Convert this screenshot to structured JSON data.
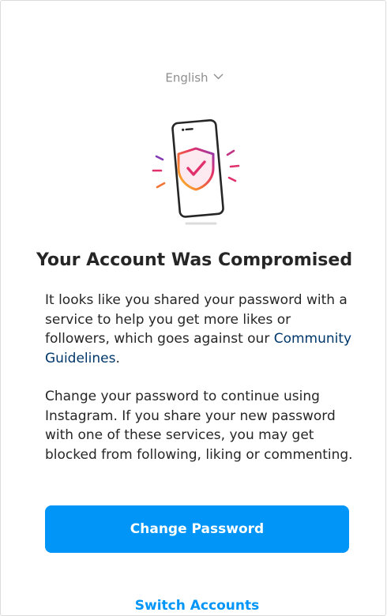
{
  "language": {
    "selected": "English",
    "icon": "chevron-down-icon"
  },
  "illustration": {
    "icon": "phone-shield-check-icon"
  },
  "title": "Your Account Was Compromised",
  "body": {
    "p1_text": "It looks like you shared your password with a service to help you get more likes or followers, which goes against our ",
    "p1_link": "Community Guidelines",
    "p1_end": ".",
    "p2_text": "Change your password to continue using Instagram. If you share your new password with one of these services, you may get blocked from following, liking or commenting."
  },
  "actions": {
    "primary_label": "Change Password",
    "secondary_label": "Switch Accounts"
  },
  "colors": {
    "primary": "#0095f6",
    "text": "#262626",
    "muted": "#8e8e8e",
    "link": "#00376b"
  }
}
